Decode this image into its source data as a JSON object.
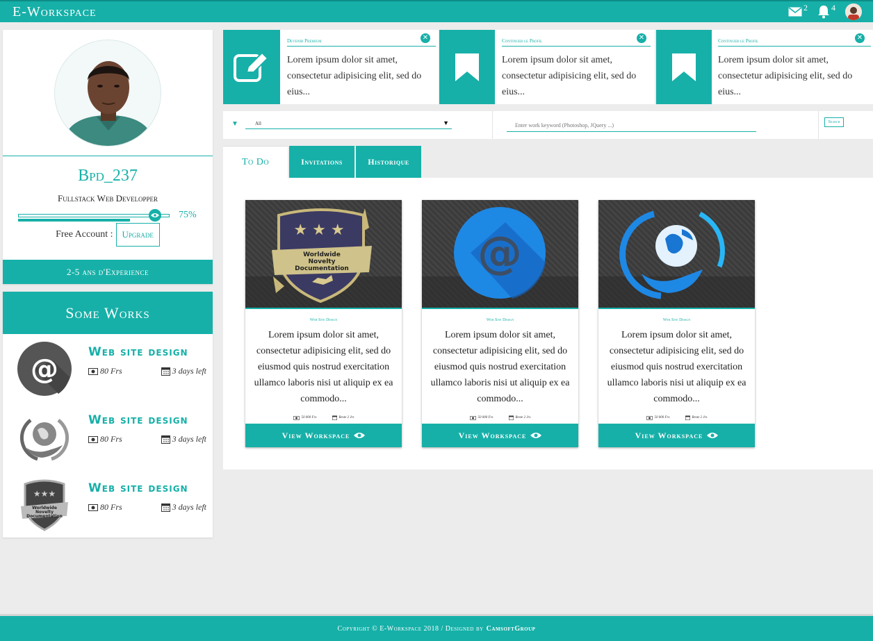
{
  "app": {
    "brand": "E-Workspace"
  },
  "header": {
    "messages_count": "2",
    "notifications_count": "4"
  },
  "profile": {
    "username": "Bpd_237",
    "role": "Fullstack Web Developper",
    "progress_percent": 75,
    "progress_label": "75%",
    "account_label": "Free Account :",
    "upgrade_label": "Upgrade",
    "experience": "2-5 ans d'Experience"
  },
  "works": {
    "title": "Some Works",
    "items": [
      {
        "name": "Web site design",
        "price": "80 Frs",
        "deadline": "3 days left",
        "thumb": "at-sign"
      },
      {
        "name": "Web site design",
        "price": "80 Frs",
        "deadline": "3 days left",
        "thumb": "globe-hand"
      },
      {
        "name": "Web site design",
        "price": "80 Frs",
        "deadline": "3 days left",
        "thumb": "badge"
      }
    ]
  },
  "notifications": [
    {
      "title": "Devenir Premium",
      "text": "Lorem ipsum dolor sit amet, consectetur adipisicing elit, sed do eius...",
      "icon": "edit-icon"
    },
    {
      "title": "Continuer le Profil",
      "text": "Lorem ipsum dolor sit amet, consectetur adipisicing elit, sed do eius...",
      "icon": "bookmark-icon"
    },
    {
      "title": "Continuer le Profil",
      "text": "Lorem ipsum dolor sit amet, consectetur adipisicing elit, sed do eius...",
      "icon": "bookmark-icon"
    }
  ],
  "filter": {
    "select_value": "All",
    "search_placeholder": "Enter work keyword (Photoshop, JQuery ...)",
    "search_button": "Search"
  },
  "tabs": [
    {
      "label": "To Do",
      "active": true
    },
    {
      "label": "Invitations",
      "active": false
    },
    {
      "label": "Historique",
      "active": false
    }
  ],
  "cards": [
    {
      "category": "Web Site Design",
      "text": "Lorem ipsum dolor sit amet, consectetur adipisicing elit, sed do eiusmod quis nostrud exercitation ullamco laboris nisi ut aliquip ex ea commodo...",
      "price": "50 000 Frs",
      "deadline": "Reste 2 Jrs",
      "button": "View Workspace",
      "image": "badge"
    },
    {
      "category": "Web Site Design",
      "text": "Lorem ipsum dolor sit amet, consectetur adipisicing elit, sed do eiusmod quis nostrud exercitation ullamco laboris nisi ut aliquip ex ea commodo...",
      "price": "50 000 Frs",
      "deadline": "Reste 2 Jrs",
      "button": "View Workspace",
      "image": "at-sign"
    },
    {
      "category": "Web Site Design",
      "text": "Lorem ipsum dolor sit amet, consectetur adipisicing elit, sed do eiusmod quis nostrud exercitation ullamco laboris nisi ut aliquip ex ea commodo...",
      "price": "50 000 Frs",
      "deadline": "Reste 2 Jrs",
      "button": "View Workspace",
      "image": "globe-hand"
    }
  ],
  "badge_text": [
    "Worldwide",
    "Novelty",
    "Documentation"
  ],
  "footer": {
    "copyright": "Copyright © E-Workspace 2018 / Designed by",
    "designer": "CamsoftGroup"
  },
  "colors": {
    "accent": "#16b0a8",
    "background": "#ececec"
  }
}
